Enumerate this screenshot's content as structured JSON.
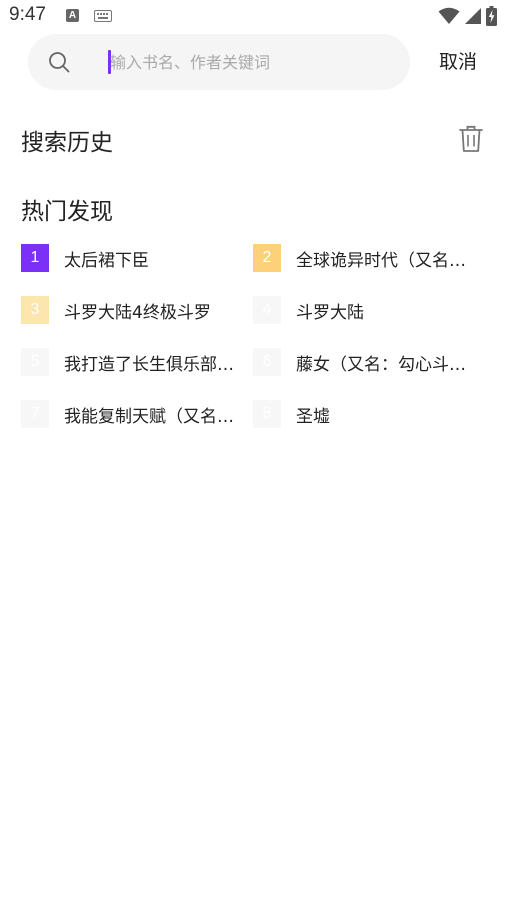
{
  "status_bar": {
    "time": "9:47",
    "input_indicator": "A",
    "icons": [
      "keyboard-icon",
      "wifi-icon",
      "signal-icon",
      "battery-charging-icon"
    ]
  },
  "search": {
    "placeholder": "输入书名、作者关键词",
    "value": "",
    "cancel_label": "取消"
  },
  "history": {
    "title": "搜索历史",
    "clear_icon": "trash-icon"
  },
  "hot": {
    "title": "热门发现",
    "items": [
      {
        "rank": "1",
        "title": "太后裙下臣",
        "badge_color": "#7b2ff7"
      },
      {
        "rank": "2",
        "title": "全球诡异时代（又名：全球…",
        "badge_color": "#fdd07a"
      },
      {
        "rank": "3",
        "title": "斗罗大陆4终极斗罗",
        "badge_color": "#fde6ad"
      },
      {
        "rank": "4",
        "title": "斗罗大陆",
        "badge_color": "#f7f7f7"
      },
      {
        "rank": "5",
        "title": "我打造了长生俱乐部（又名…",
        "badge_color": "#f7f7f7"
      },
      {
        "rank": "6",
        "title": "藤女（又名：勾心斗角…",
        "badge_color": "#f7f7f7"
      },
      {
        "rank": "7",
        "title": "我能复制天赋（又名：我能…",
        "badge_color": "#f7f7f7"
      },
      {
        "rank": "8",
        "title": "圣墟",
        "badge_color": "#f7f7f7"
      }
    ]
  }
}
